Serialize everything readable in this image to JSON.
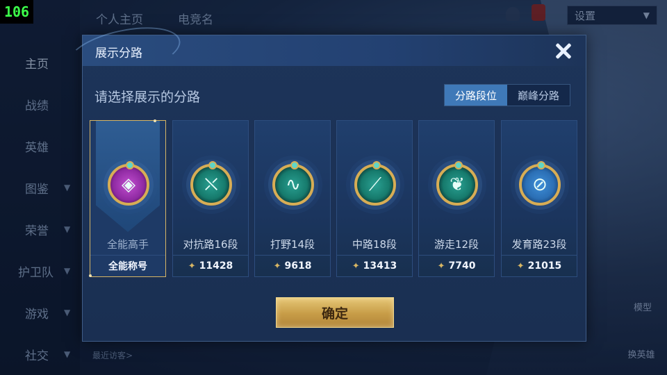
{
  "fps": "106",
  "sidebar": {
    "items": [
      {
        "label": "主页",
        "chevron": false
      },
      {
        "label": "战绩",
        "chevron": false
      },
      {
        "label": "英雄",
        "chevron": false
      },
      {
        "label": "图鉴",
        "chevron": true
      },
      {
        "label": "荣誉",
        "chevron": true
      },
      {
        "label": "护卫队",
        "chevron": true
      },
      {
        "label": "游戏",
        "chevron": true
      },
      {
        "label": "社交",
        "chevron": true
      }
    ]
  },
  "top_tabs": [
    "个人主页",
    "电竞名"
  ],
  "settings_label": "设置",
  "recent_visitors_label": "最近访客>",
  "right_controls": {
    "model": "模型",
    "switch_hero": "换英雄"
  },
  "modal": {
    "title": "展示分路",
    "subtitle": "请选择展示的分路",
    "toggle": {
      "options": [
        "分路段位",
        "巅峰分路"
      ],
      "selected": 0
    },
    "confirm_label": "确定",
    "cards": [
      {
        "rank": "全能高手",
        "footer": "全能称号",
        "selected": true,
        "icon": "all-round-emblem-icon",
        "glyph": "◈",
        "color": "#9b2fb0"
      },
      {
        "rank": "对抗路16段",
        "footer": "11428",
        "selected": false,
        "icon": "clash-lane-emblem-icon",
        "glyph": "⛌",
        "color": "#1f8f82"
      },
      {
        "rank": "打野14段",
        "footer": "9618",
        "selected": false,
        "icon": "jungle-dragon-emblem-icon",
        "glyph": "∿",
        "color": "#1f8f82"
      },
      {
        "rank": "中路18段",
        "footer": "13413",
        "selected": false,
        "icon": "mid-lane-emblem-icon",
        "glyph": "⟋",
        "color": "#1f8f82"
      },
      {
        "rank": "游走12段",
        "footer": "7740",
        "selected": false,
        "icon": "roam-wings-emblem-icon",
        "glyph": "❦",
        "color": "#1f8f82"
      },
      {
        "rank": "发育路23段",
        "footer": "21015",
        "selected": false,
        "icon": "farm-lane-emblem-icon",
        "glyph": "⊘",
        "color": "#2b6fb5"
      }
    ]
  }
}
